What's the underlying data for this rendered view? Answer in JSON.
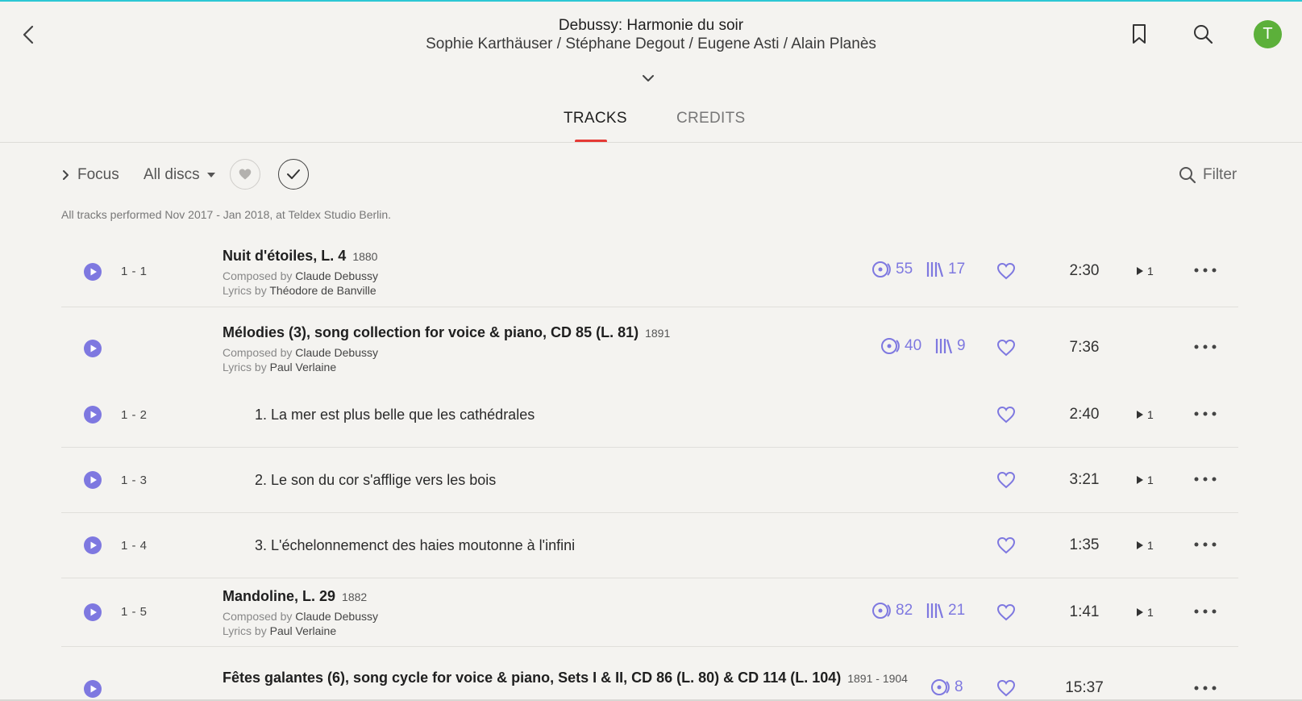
{
  "header": {
    "title": "Debussy: Harmonie du soir",
    "artists": "Sophie Karthäuser / Stéphane Degout / Eugene Asti / Alain Planès",
    "avatar_initial": "T"
  },
  "tabs": [
    {
      "label": "TRACKS",
      "active": true
    },
    {
      "label": "CREDITS",
      "active": false
    }
  ],
  "toolbar": {
    "focus_label": "Focus",
    "discs_label": "All discs",
    "filter_label": "Filter"
  },
  "performance_note": "All tracks performed Nov 2017 - Jan 2018, at Teldex Studio Berlin.",
  "colors": {
    "accent": "#7e78e0",
    "tab_underline": "#e53935",
    "avatar": "#5cb03a",
    "top_line": "#2cc7d4"
  },
  "tracks": [
    {
      "position": "1 - 1",
      "title": "Nuit d'étoiles, L. 4",
      "year": "1880",
      "composed_prefix": "Composed by",
      "composer": "Claude Debussy",
      "lyrics_prefix": "Lyrics by",
      "lyricist": "Théodore de Banville",
      "listens": "55",
      "library": "17",
      "duration": "2:30",
      "plays": "1"
    },
    {
      "title": "Mélodies (3), song collection for voice & piano, CD 85 (L. 81)",
      "year": "1891",
      "composed_prefix": "Composed by",
      "composer": "Claude Debussy",
      "lyrics_prefix": "Lyrics by",
      "lyricist": "Paul Verlaine",
      "listens": "40",
      "library": "9",
      "duration": "7:36"
    },
    {
      "position": "1 - 2",
      "title": "1. La mer est plus belle que les cathédrales",
      "duration": "2:40",
      "plays": "1"
    },
    {
      "position": "1 - 3",
      "title": "2. Le son du cor s'afflige vers les bois",
      "duration": "3:21",
      "plays": "1"
    },
    {
      "position": "1 - 4",
      "title": "3. L'échelonnemenct des haies moutonne à l'infini",
      "duration": "1:35",
      "plays": "1"
    },
    {
      "position": "1 - 5",
      "title": "Mandoline, L. 29",
      "year": "1882",
      "composed_prefix": "Composed by",
      "composer": "Claude Debussy",
      "lyrics_prefix": "Lyrics by",
      "lyricist": "Paul Verlaine",
      "listens": "82",
      "library": "21",
      "duration": "1:41",
      "plays": "1"
    },
    {
      "title": "Fêtes galantes (6), song cycle for voice & piano, Sets I & II, CD 86 (L. 80) & CD 114 (L. 104)",
      "year": "1891 - 1904",
      "listens": "8",
      "duration": "15:37"
    }
  ],
  "icons": {
    "back": "chevron-left-icon",
    "bookmark": "bookmark-icon",
    "search": "search-icon",
    "expand": "chevron-down-icon",
    "play": "play-circle-icon",
    "listens": "listens-icon",
    "library": "library-icon",
    "heart": "heart-icon",
    "more": "more-icon"
  }
}
